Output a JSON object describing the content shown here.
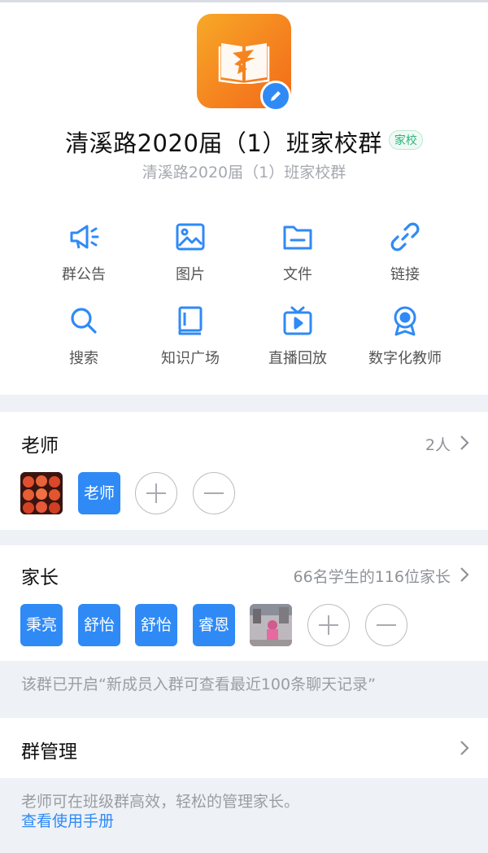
{
  "colors": {
    "accent": "#2f8af6",
    "tag_green": "#2fb37a",
    "avatar_orange": "#f5841f"
  },
  "group": {
    "name": "清溪路2020届（1）班家校群",
    "tag": "家校",
    "subname": "清溪路2020届（1）班家校群",
    "avatar_icon": "book-logo-icon",
    "edit_icon": "pencil-icon"
  },
  "functions": [
    {
      "label": "群公告",
      "icon": "megaphone-icon"
    },
    {
      "label": "图片",
      "icon": "image-icon"
    },
    {
      "label": "文件",
      "icon": "folder-icon"
    },
    {
      "label": "链接",
      "icon": "link-icon"
    },
    {
      "label": "搜索",
      "icon": "search-icon"
    },
    {
      "label": "知识广场",
      "icon": "book-icon"
    },
    {
      "label": "直播回放",
      "icon": "tv-play-icon"
    },
    {
      "label": "数字化教师",
      "icon": "badge-icon"
    }
  ],
  "teachers": {
    "title": "老师",
    "count": "2人",
    "members": [
      {
        "type": "photo"
      },
      {
        "type": "name",
        "label": "老师"
      }
    ]
  },
  "parents": {
    "title": "家长",
    "count": "66名学生的116位家长",
    "members": [
      {
        "type": "name",
        "label": "秉亮"
      },
      {
        "type": "name",
        "label": "舒怡"
      },
      {
        "type": "name",
        "label": "舒怡"
      },
      {
        "type": "name",
        "label": "睿恩"
      },
      {
        "type": "photo"
      }
    ],
    "history_note": "该群已开启“新成员入群可查看最近100条聊天记录”"
  },
  "management": {
    "title": "群管理",
    "note": "老师可在班级群高效，轻松的管理家长。",
    "manual_link": "查看使用手册"
  }
}
